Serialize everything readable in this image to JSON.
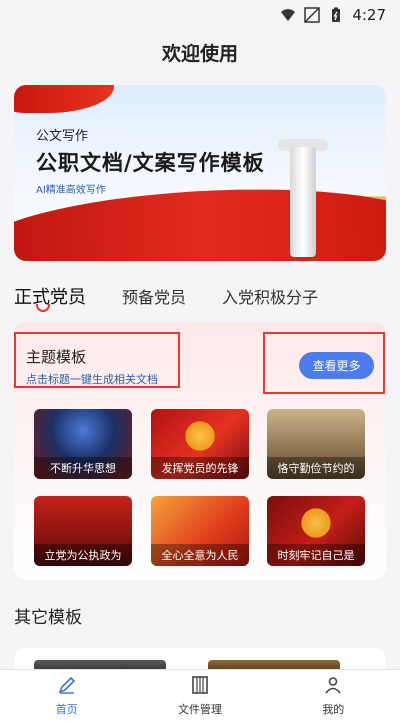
{
  "status_bar": {
    "time": "4:27",
    "icons": [
      "wifi-icon",
      "signal-icon",
      "battery-icon"
    ]
  },
  "header": {
    "title": "欢迎使用"
  },
  "banner": {
    "small_title": "公文写作",
    "title": "公职文档/文案写作模板",
    "subtitle": "AI精准高效写作"
  },
  "tabs": [
    {
      "label": "正式党员",
      "active": true
    },
    {
      "label": "预备党员",
      "active": false
    },
    {
      "label": "入党积极分子",
      "active": false
    }
  ],
  "theme_section": {
    "title": "主题模板",
    "subtitle": "点击标题一键生成相关文档",
    "more_label": "查看更多",
    "tiles": [
      {
        "label": "不断升华思想"
      },
      {
        "label": "发挥党员的先锋"
      },
      {
        "label": "恪守勤俭节约的"
      },
      {
        "label": "立党为公执政为"
      },
      {
        "label": "全心全意为人民"
      },
      {
        "label": "时刻牢记自己是"
      }
    ]
  },
  "other_section": {
    "title": "其它模板"
  },
  "bottom_nav": [
    {
      "label": "首页",
      "icon": "pen-icon",
      "active": true
    },
    {
      "label": "文件管理",
      "icon": "file-cabinet-icon",
      "active": false
    },
    {
      "label": "我的",
      "icon": "user-icon",
      "active": false
    }
  ],
  "colors": {
    "accent_blue": "#4b7bec",
    "highlight_red": "#e53935",
    "link_blue": "#2a5db0"
  }
}
